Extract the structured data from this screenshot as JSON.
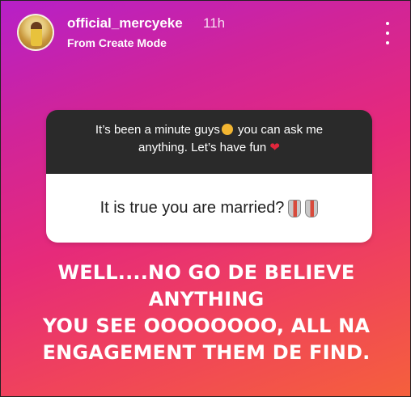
{
  "header": {
    "username": "official_mercyeke",
    "time": "11h",
    "subtitle": "From Create Mode"
  },
  "question_card": {
    "prompt_part1": "It’s been a minute guys",
    "prompt_part2": " you can ask me anything. Let’s have fun ",
    "question": "It is true you are married?"
  },
  "caption": {
    "line1": "WELL....NO GO DE BELIEVE  ANYTHING",
    "line2": "YOU SEE OOOOOOOO, ALL NA",
    "line3": "ENGAGEMENT THEM DE FIND."
  },
  "icons": {
    "avatar": "avatar-photo",
    "more": "more-vertical-icon",
    "face": "yawning-face-emoji",
    "heart": "red-heart-emoji",
    "shield": "shield-emoji"
  },
  "colors": {
    "gradient_start": "#b620c8",
    "gradient_end": "#f5603c",
    "card_top": "#2a2a2a",
    "card_bottom": "#ffffff"
  }
}
